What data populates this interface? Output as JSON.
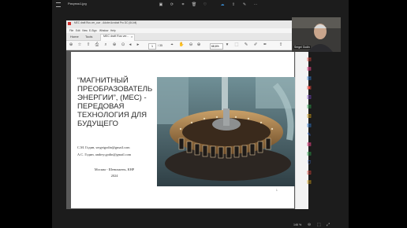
{
  "outer_window": {
    "title": "Рисунок1.jpg",
    "toolbar_icons": [
      "photos-icon",
      "rotate-icon",
      "crop-icon",
      "delete-icon",
      "favorite-icon",
      "cloud-icon",
      "share-icon",
      "edit-icon",
      "more-icon"
    ],
    "zoom_level": "146 %"
  },
  "inner_window": {
    "title": "МЕС draft Rus ver_curr - Adobe Acrobat Pro DC (64-bit)",
    "menu": [
      "File",
      "Edit",
      "View",
      "E-Sign",
      "Window",
      "Help"
    ],
    "tabs": [
      {
        "label": "Home"
      },
      {
        "label": "Tools"
      },
      {
        "label": "МЕС draft Rus ver..."
      }
    ],
    "toolbar": {
      "page_current": "1",
      "page_total": "/ 35",
      "zoom": "68,6%"
    },
    "sidebar_colors": [
      "#e0453a",
      "#d43f7c",
      "#2f7ed8",
      "#e0453a",
      "#7a46c9",
      "#2aa54b",
      "#d4a017",
      "#2f7ed8",
      "#3b6fd1",
      "#d43f7c",
      "#2aa54b",
      "#d4a017",
      "#e0453a",
      "#3b6fd1"
    ]
  },
  "slide": {
    "title": "“МАГНИТНЫЙ ПРЕОБРАЗОВАТЕЛЬ ЭНЕРГИИ”, (МЕС) - ПЕРЕДОВАЯ ТЕХНОЛОГИЯ ДЛЯ БУДУЩЕГО",
    "authors": [
      "С.М. Годин, sergeigodin@gmail.com",
      "А.С. Годин, andrey.godin@gmail.com"
    ],
    "city": "Москва - Шеньчжень, КНР",
    "year": "2024",
    "page_number": "1"
  },
  "participant": {
    "name": "Sergei Godin"
  }
}
